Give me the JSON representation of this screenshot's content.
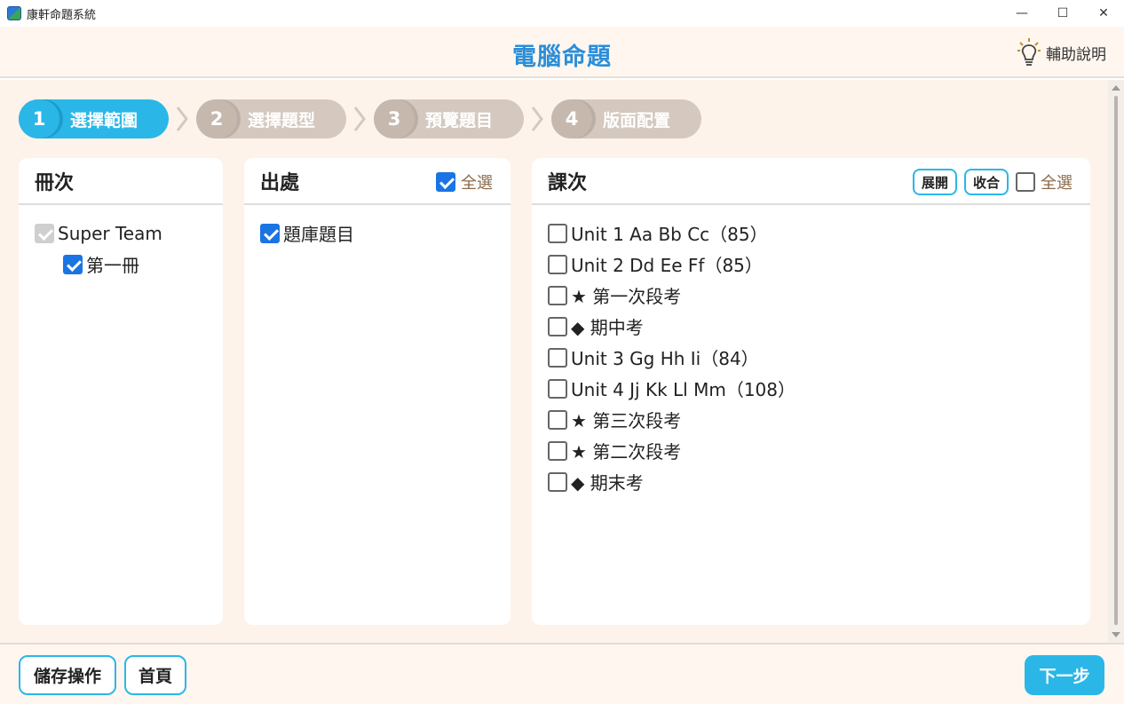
{
  "window": {
    "title": "康軒命題系統",
    "minimize": "—",
    "maximize": "☐",
    "close": "✕"
  },
  "header": {
    "title": "電腦命題",
    "help_label": "輔助說明",
    "help_icon": "lightbulb-icon"
  },
  "steps": [
    {
      "num": "1",
      "label": "選擇範圍",
      "active": true
    },
    {
      "num": "2",
      "label": "選擇題型",
      "active": false
    },
    {
      "num": "3",
      "label": "預覽題目",
      "active": false
    },
    {
      "num": "4",
      "label": "版面配置",
      "active": false
    }
  ],
  "volume_panel": {
    "title": "冊次",
    "items": [
      {
        "label": "Super Team",
        "state": "disabled-checked"
      },
      {
        "label": "第一冊",
        "state": "checked"
      }
    ]
  },
  "source_panel": {
    "title": "出處",
    "select_all_label": "全選",
    "select_all_checked": true,
    "items": [
      {
        "label": "題庫題目",
        "state": "checked"
      }
    ]
  },
  "lesson_panel": {
    "title": "課次",
    "expand_label": "展開",
    "collapse_label": "收合",
    "select_all_label": "全選",
    "select_all_checked": false,
    "items": [
      "Unit 1 Aa Bb Cc（85）",
      "Unit 2 Dd Ee Ff（85）",
      "★ 第一次段考",
      "◆ 期中考",
      "Unit 3 Gg Hh Ii（84）",
      "Unit 4 Jj Kk Ll Mm（108）",
      "★ 第三次段考",
      "★ 第二次段考",
      "◆ 期末考"
    ]
  },
  "footer": {
    "save_label": "儲存操作",
    "home_label": "首頁",
    "next_label": "下一步"
  },
  "colors": {
    "accent": "#2ab7e8",
    "title_blue": "#2b8ed8",
    "background": "#fef3ea",
    "step_inactive": "#d4c8bf"
  }
}
